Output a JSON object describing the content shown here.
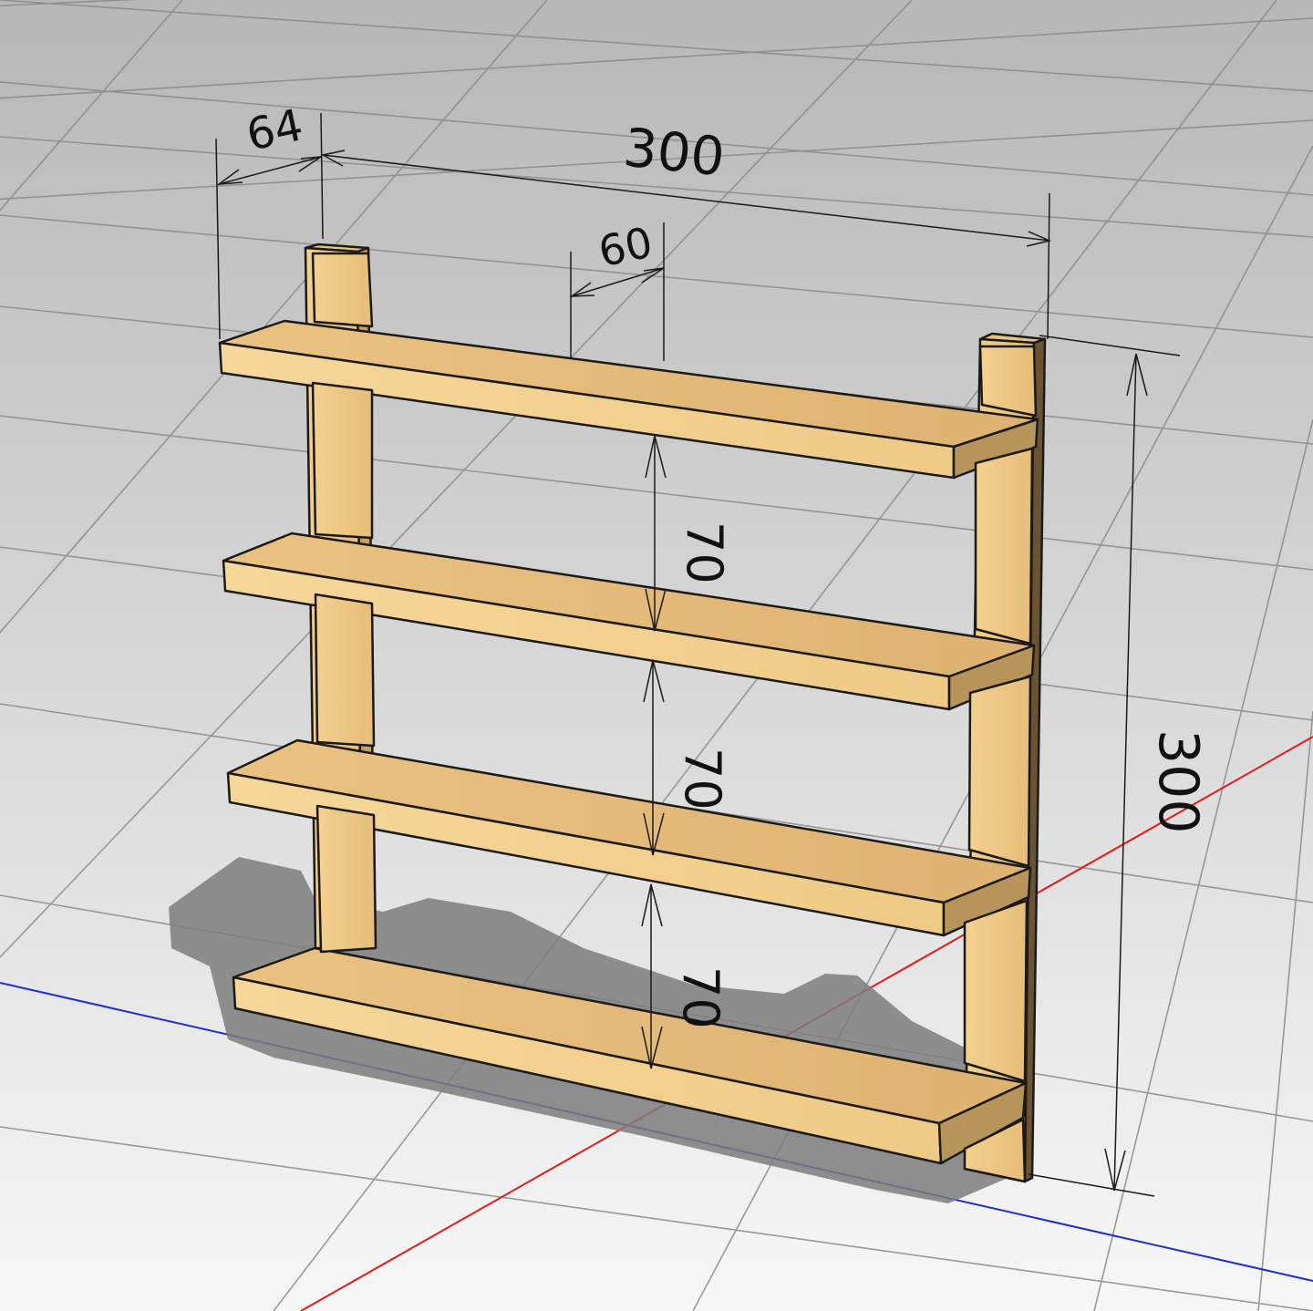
{
  "scene": {
    "background_top": "#b9b9b9",
    "background_bottom": "#f4f4f4",
    "grid_color": "#8e8e8e",
    "axis_x_color": "#e31a1a",
    "axis_y_color": "#1f2bd6",
    "wood_light": "#f3cf8d",
    "wood_mid": "#e9bf7a",
    "wood_dark": "#c9a062",
    "outline_color": "#1a1a1a",
    "shadow_color": "#7a7a7a"
  },
  "dimensions": {
    "depth_label": "64",
    "width_label": "300",
    "offset_label": "60",
    "spacing_1_label": "70",
    "spacing_2_label": "70",
    "spacing_3_label": "70",
    "height_label": "300"
  }
}
